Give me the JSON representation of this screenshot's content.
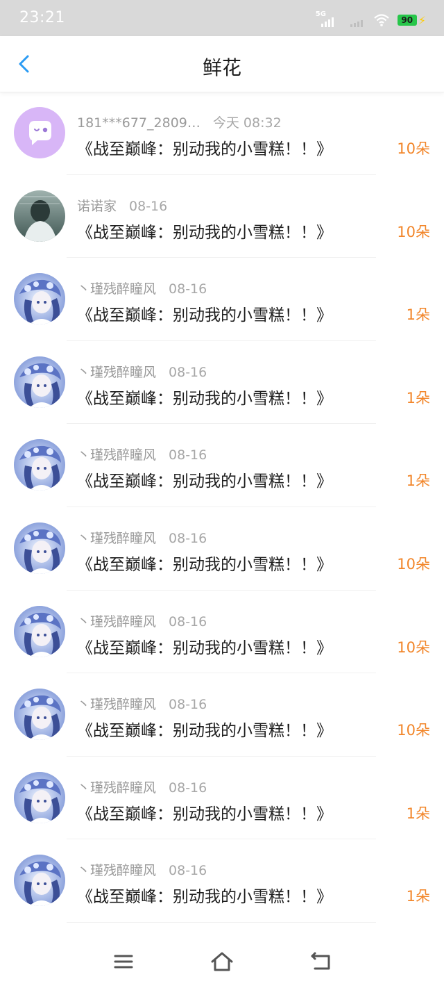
{
  "status_bar": {
    "time": "23:21",
    "network": "5G",
    "battery": "90"
  },
  "header": {
    "title": "鲜花"
  },
  "icons": {
    "back": "chevron-left-icon",
    "menu": "menu-icon",
    "home": "home-icon",
    "return": "return-icon"
  },
  "colors": {
    "accent": "#2a9bf4",
    "count": "#f2862a",
    "avatar_purple": "#d8b6f7"
  },
  "items": [
    {
      "user": "181***677_2809…",
      "date": "今天 08:32",
      "title": "《战至巅峰：别动我的小雪糕！！》",
      "count": "10朵",
      "avatar": "purple"
    },
    {
      "user": "诺诺家",
      "date": "08-16",
      "title": "《战至巅峰：别动我的小雪糕！！》",
      "count": "10朵",
      "avatar": "photo"
    },
    {
      "user": "丶瑾残醉瞳风",
      "date": "08-16",
      "title": "《战至巅峰：别动我的小雪糕！！》",
      "count": "1朵",
      "avatar": "anime"
    },
    {
      "user": "丶瑾残醉瞳风",
      "date": "08-16",
      "title": "《战至巅峰：别动我的小雪糕！！》",
      "count": "1朵",
      "avatar": "anime"
    },
    {
      "user": "丶瑾残醉瞳风",
      "date": "08-16",
      "title": "《战至巅峰：别动我的小雪糕！！》",
      "count": "1朵",
      "avatar": "anime"
    },
    {
      "user": "丶瑾残醉瞳风",
      "date": "08-16",
      "title": "《战至巅峰：别动我的小雪糕！！》",
      "count": "10朵",
      "avatar": "anime"
    },
    {
      "user": "丶瑾残醉瞳风",
      "date": "08-16",
      "title": "《战至巅峰：别动我的小雪糕！！》",
      "count": "10朵",
      "avatar": "anime"
    },
    {
      "user": "丶瑾残醉瞳风",
      "date": "08-16",
      "title": "《战至巅峰：别动我的小雪糕！！》",
      "count": "10朵",
      "avatar": "anime"
    },
    {
      "user": "丶瑾残醉瞳风",
      "date": "08-16",
      "title": "《战至巅峰：别动我的小雪糕！！》",
      "count": "1朵",
      "avatar": "anime"
    },
    {
      "user": "丶瑾残醉瞳风",
      "date": "08-16",
      "title": "《战至巅峰：别动我的小雪糕！！》",
      "count": "1朵",
      "avatar": "anime"
    }
  ]
}
